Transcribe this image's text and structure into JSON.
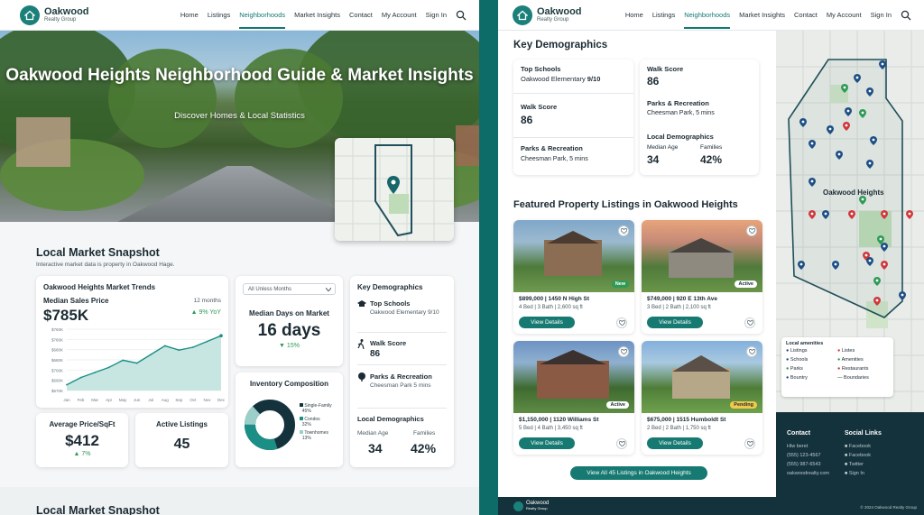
{
  "brand": {
    "name": "Oakwood",
    "sub": "Realty Group"
  },
  "nav": {
    "items": [
      "Home",
      "Listings",
      "Neighborhoods",
      "Market Insights",
      "Contact",
      "My Account",
      "Sign In"
    ],
    "active": "Neighborhoods"
  },
  "hero": {
    "title": "Oakwood Heights Neighborhood Guide & Market Insights",
    "subtitle": "Discover Homes & Local Statistics"
  },
  "snapshot": {
    "title": "Local Market Snapshot",
    "subtitle": "Interactive market data is property in Oakwood Hage.",
    "trends": {
      "title": "Oakwood Heights Market Trends",
      "label": "Median Sales Price",
      "period": "12 months",
      "value": "$785K",
      "change": "▲ 9% YoY"
    },
    "dropdown": "All Unless Months",
    "days": {
      "label": "Median Days on Market",
      "value": "16 days",
      "change": "▼ 15%"
    },
    "price_sqft": {
      "label": "Average Price/SqFt",
      "value": "$412",
      "change": "▲ 7%"
    },
    "active": {
      "label": "Active Listings",
      "value": "45"
    },
    "inventory": {
      "title": "Inventory Composition",
      "legend": [
        {
          "label": "Single-Family",
          "pct": "45%",
          "color": "#14323c"
        },
        {
          "label": "Condos",
          "pct": "32%",
          "color": "#1b8f85"
        },
        {
          "label": "Townhomes",
          "pct": "13%",
          "color": "#9ccfc9"
        }
      ]
    },
    "demographics_card": {
      "title": "Key Demographics",
      "schools_label": "Top Schools",
      "schools_value": "Oakwood Elementary 9/10",
      "walk_label": "Walk Score",
      "walk_value": "86",
      "parks_label": "Parks & Recreation",
      "parks_value": "Cheesman Park 5 mins",
      "local_label": "Local Demographics",
      "age_label": "Median Age",
      "age_value": "34",
      "families_label": "Families",
      "families_value": "42%"
    },
    "footer_title": "Local Market Snapshot"
  },
  "chart_data": {
    "type": "area",
    "x": [
      "Jan",
      "Feb",
      "Mar",
      "Apr",
      "May",
      "Jun",
      "Jul",
      "Aug",
      "Sep",
      "Oct",
      "Nov",
      "Dec"
    ],
    "values": [
      718,
      728,
      735,
      742,
      752,
      748,
      760,
      772,
      766,
      770,
      778,
      786
    ],
    "ytick_labels": [
      "$760K",
      "$780K",
      "$680K",
      "$680K",
      "$700K",
      "$690K",
      "$670K"
    ],
    "ylim": [
      710,
      795
    ],
    "title": "",
    "xlabel": "",
    "ylabel": "",
    "color": "#1b8f85"
  },
  "right": {
    "demo_title": "Key Demographics",
    "schools_label": "Top Schools",
    "schools_value": "Oakwood Elementary",
    "schools_score": "9/10",
    "walk_label": "Walk Score",
    "walk_value": "86",
    "walk2_label": "Walk Score",
    "walk2_value": "86",
    "parks_label": "Parks & Recreation",
    "parks_value": "Cheesman Park, 5 mins",
    "parks2_label": "Parks & Recreation",
    "parks2_value": "Cheesman Park, 5 mins",
    "local_label": "Local Demographics",
    "age_label": "Median Age",
    "age_value": "34",
    "families_label": "Families",
    "families_value": "42%",
    "listings_title": "Featured Property Listings in Oakwood Heights",
    "listings": [
      {
        "price": "$899,000 | 1450 N High St",
        "details": "4 Bed | 3 Bath | 2,600 sq ft",
        "tag": "New",
        "tagcolor": "#2e9a55"
      },
      {
        "price": "$749,000 | 920 E 13th Ave",
        "details": "3 Bed | 2 Bath | 2,100 sq ft",
        "tag": "Active",
        "tagcolor": "#ffffff"
      },
      {
        "price": "$1,150,000 | 1120 Williams St",
        "details": "5 Bed | 4 Bath | 3,450 sq ft",
        "tag": "Active",
        "tagcolor": "#ffffff"
      },
      {
        "price": "$675,000 | 1515 Humboldt St",
        "details": "2 Bed | 2 Bath | 1,750 sq ft",
        "tag": "Pending",
        "tagcolor": "#f2c94c"
      }
    ],
    "view_details": "View Details",
    "view_all": "View All 45 Listings in Oakwood Heights",
    "map_label": "Oakwood Heights",
    "map_legend_title": "Local amenities",
    "map_legend": [
      "Listings",
      "Listes",
      "Schools",
      "Amenities",
      "Parks",
      "Restaurants",
      "Bountry",
      "Boundaries"
    ],
    "contact": {
      "title": "Contact",
      "lines": [
        "Hlw beret",
        "(555) 123-4567",
        "(555) 987-6543",
        "oakwoodrealty.com"
      ]
    },
    "social": {
      "title": "Social Links",
      "lines": [
        "Facebook",
        "Facebook",
        "Twitter",
        "Sign In"
      ]
    },
    "copyright": "© 2024 Oakwood Realty Group"
  }
}
